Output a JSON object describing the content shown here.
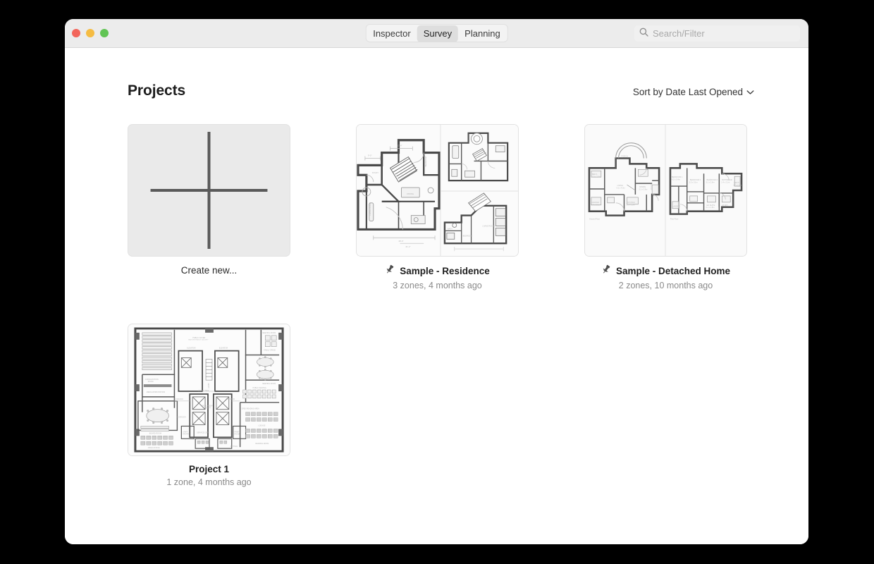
{
  "window": {
    "traffic_lights": [
      {
        "name": "close",
        "color": "#f2655b"
      },
      {
        "name": "minimize",
        "color": "#f5bc43"
      },
      {
        "name": "zoom",
        "color": "#61c454"
      }
    ]
  },
  "toolbar": {
    "tabs": [
      {
        "label": "Inspector",
        "active": false
      },
      {
        "label": "Survey",
        "active": true
      },
      {
        "label": "Planning",
        "active": false
      }
    ],
    "search": {
      "icon": "search-icon",
      "placeholder": "Search/Filter",
      "value": ""
    }
  },
  "header": {
    "title": "Projects",
    "sort": {
      "label": "Sort by Date Last Opened",
      "icon": "chevron-down-icon"
    }
  },
  "projects": [
    {
      "type": "create",
      "label": "Create new...",
      "icon": "plus-icon"
    },
    {
      "type": "project",
      "title": "Sample - Residence",
      "subtitle": "3 zones, 4 months ago",
      "zones": 3,
      "last_opened": "4 months ago",
      "pinned": true,
      "thumbnail": "floorplan-residence-three-panel"
    },
    {
      "type": "project",
      "title": "Sample - Detached Home",
      "subtitle": "2 zones, 10 months ago",
      "zones": 2,
      "last_opened": "10 months ago",
      "pinned": true,
      "thumbnail": "floorplan-detached-two-panel"
    },
    {
      "type": "project",
      "title": "Project 1",
      "subtitle": "1 zone, 4 months ago",
      "zones": 1,
      "last_opened": "4 months ago",
      "pinned": false,
      "thumbnail": "floorplan-office-dense"
    }
  ],
  "colors": {
    "window_chrome": "#ececec",
    "content_background": "#ffffff",
    "placeholder_card": "#eaeaea",
    "card_border": "#e2e2e2",
    "title_text": "#1c1c1c",
    "subtitle_text": "#8a8a8a",
    "desktop_background": "#000000"
  }
}
